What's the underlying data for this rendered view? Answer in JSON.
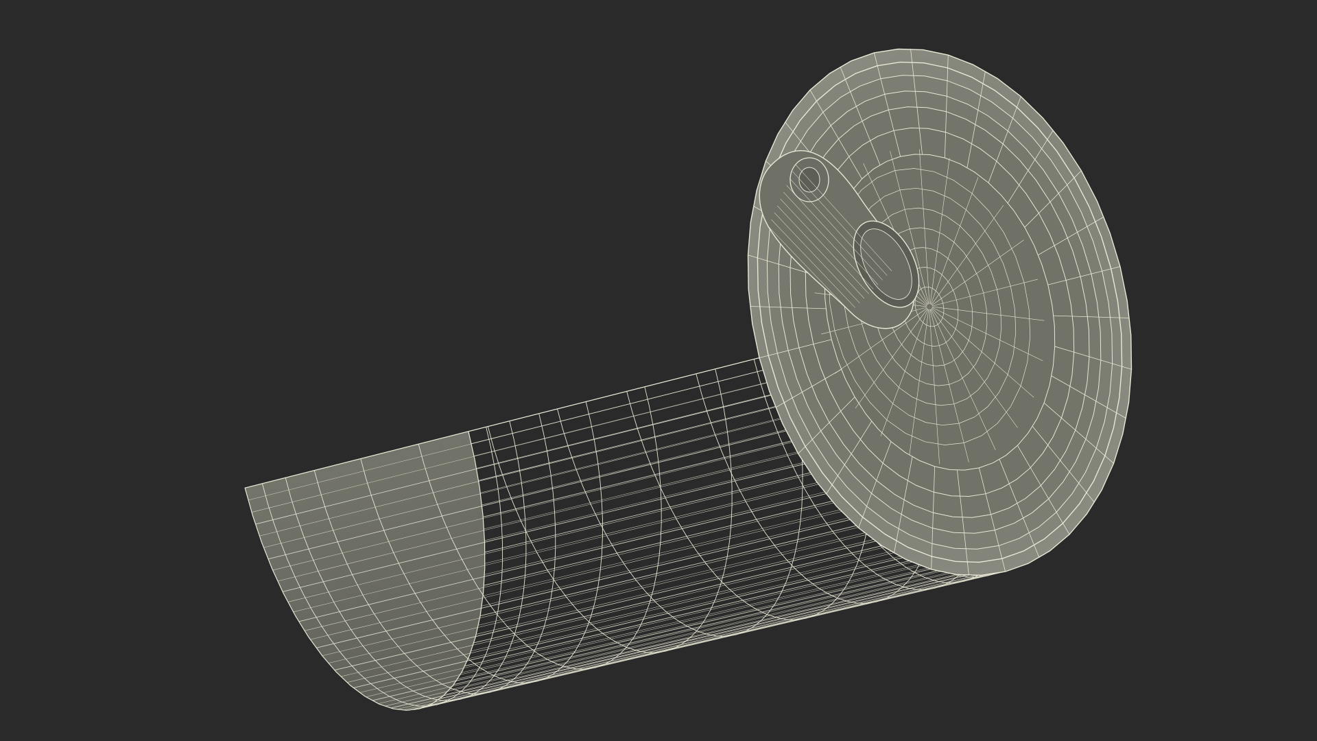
{
  "scene": {
    "subject": "wireframe-soda-can",
    "render_mode": "wireframe-over-shaded",
    "colors": {
      "background": "#2a2a2a",
      "surface": "#7b7c72",
      "surface_dark": "#5f6058",
      "surface_light": "#8d8e84",
      "wire": "#e9e8d6"
    }
  }
}
